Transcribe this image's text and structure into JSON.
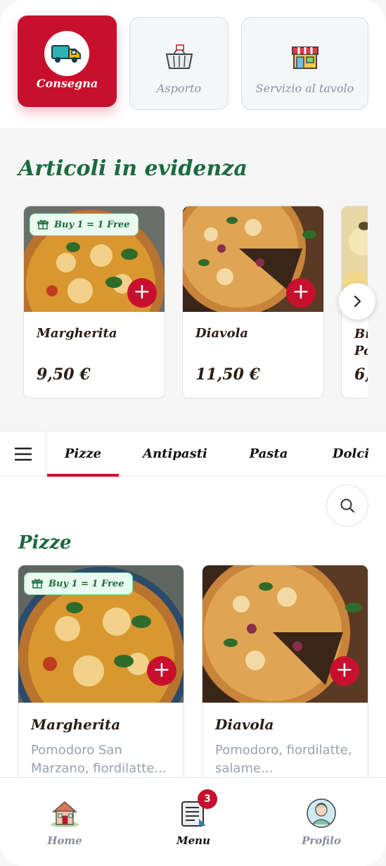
{
  "service_modes": [
    {
      "label": "Consegna",
      "icon": "delivery-truck-icon",
      "active": true
    },
    {
      "label": "Asporto",
      "icon": "shopping-basket-icon",
      "active": false
    },
    {
      "label": "Servizio al tavolo",
      "icon": "restaurant-shop-icon",
      "active": false
    }
  ],
  "featured": {
    "title": "Articoli in evidenza",
    "items": [
      {
        "name": "Margherita",
        "price": "9,50 €",
        "badge": "Buy 1 = 1 Free"
      },
      {
        "name": "Diavola",
        "price": "11,50 €"
      },
      {
        "name": "Br\nPo",
        "price": "6,"
      }
    ]
  },
  "categories": {
    "tabs": [
      "Pizze",
      "Antipasti",
      "Pasta",
      "Dolci"
    ],
    "active": "Pizze"
  },
  "list": {
    "title": "Pizze",
    "items": [
      {
        "name": "Margherita",
        "description": "Pomodoro San Marzano, fiordilatte...",
        "badge": "Buy 1 = 1 Free"
      },
      {
        "name": "Diavola",
        "description": "Pomodoro, fiordilatte, salame..."
      }
    ]
  },
  "bottom_nav": {
    "items": [
      {
        "label": "Home",
        "icon": "home-icon"
      },
      {
        "label": "Menu",
        "icon": "menu-icon",
        "badge": "3"
      },
      {
        "label": "Profilo",
        "icon": "profile-avatar-icon"
      }
    ],
    "active": "Menu"
  },
  "colors": {
    "accent": "#c8102e",
    "title_green": "#1a6b3c",
    "badge_green_bg": "#eafaf0"
  }
}
